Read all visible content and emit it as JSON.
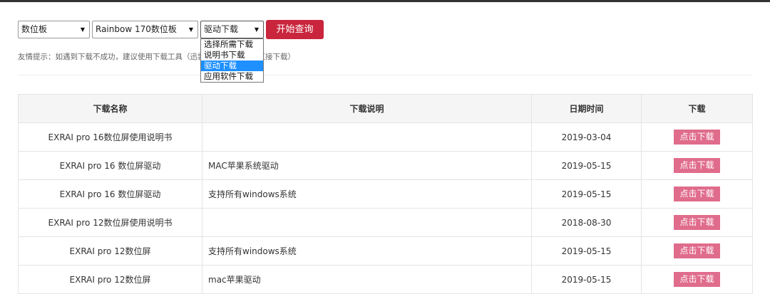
{
  "filters": {
    "category": "数位板",
    "model": "Rainbow 170数位板",
    "type": "驱动下载",
    "type_options": [
      "选择所需下载",
      "说明书下载",
      "驱动下载",
      "应用软件下载"
    ],
    "type_selected_index": 2,
    "submit_label": "开始查询",
    "arrow": "▼"
  },
  "tip": {
    "before": "友情提示：如遇到下载不成功，建议使用下载工具（迅雷",
    "after": "下载工具直接下载）"
  },
  "table": {
    "headers": [
      "下载名称",
      "下载说明",
      "日期时间",
      "下载"
    ],
    "download_label": "点击下载",
    "rows": [
      {
        "name": "EXRAI pro 16数位屏使用说明书",
        "desc": "",
        "date": "2019-03-04"
      },
      {
        "name": "EXRAI pro 16 数位屏驱动",
        "desc": "MAC苹果系统驱动",
        "date": "2019-05-15"
      },
      {
        "name": "EXRAI pro 16 数位屏驱动",
        "desc": "支持所有windows系统",
        "date": "2019-05-15"
      },
      {
        "name": "EXRAI pro 12数位屏使用说明书",
        "desc": "",
        "date": "2018-08-30"
      },
      {
        "name": "EXRAI pro 12数位屏",
        "desc": "支持所有windows系统",
        "date": "2019-05-15"
      },
      {
        "name": "EXRAI pro 12数位屏",
        "desc": "mac苹果驱动",
        "date": "2019-05-15"
      }
    ]
  },
  "colors": {
    "submit": "#c9253c",
    "download_button": "#e06c8c",
    "dropdown_highlight": "#1e90ff"
  }
}
